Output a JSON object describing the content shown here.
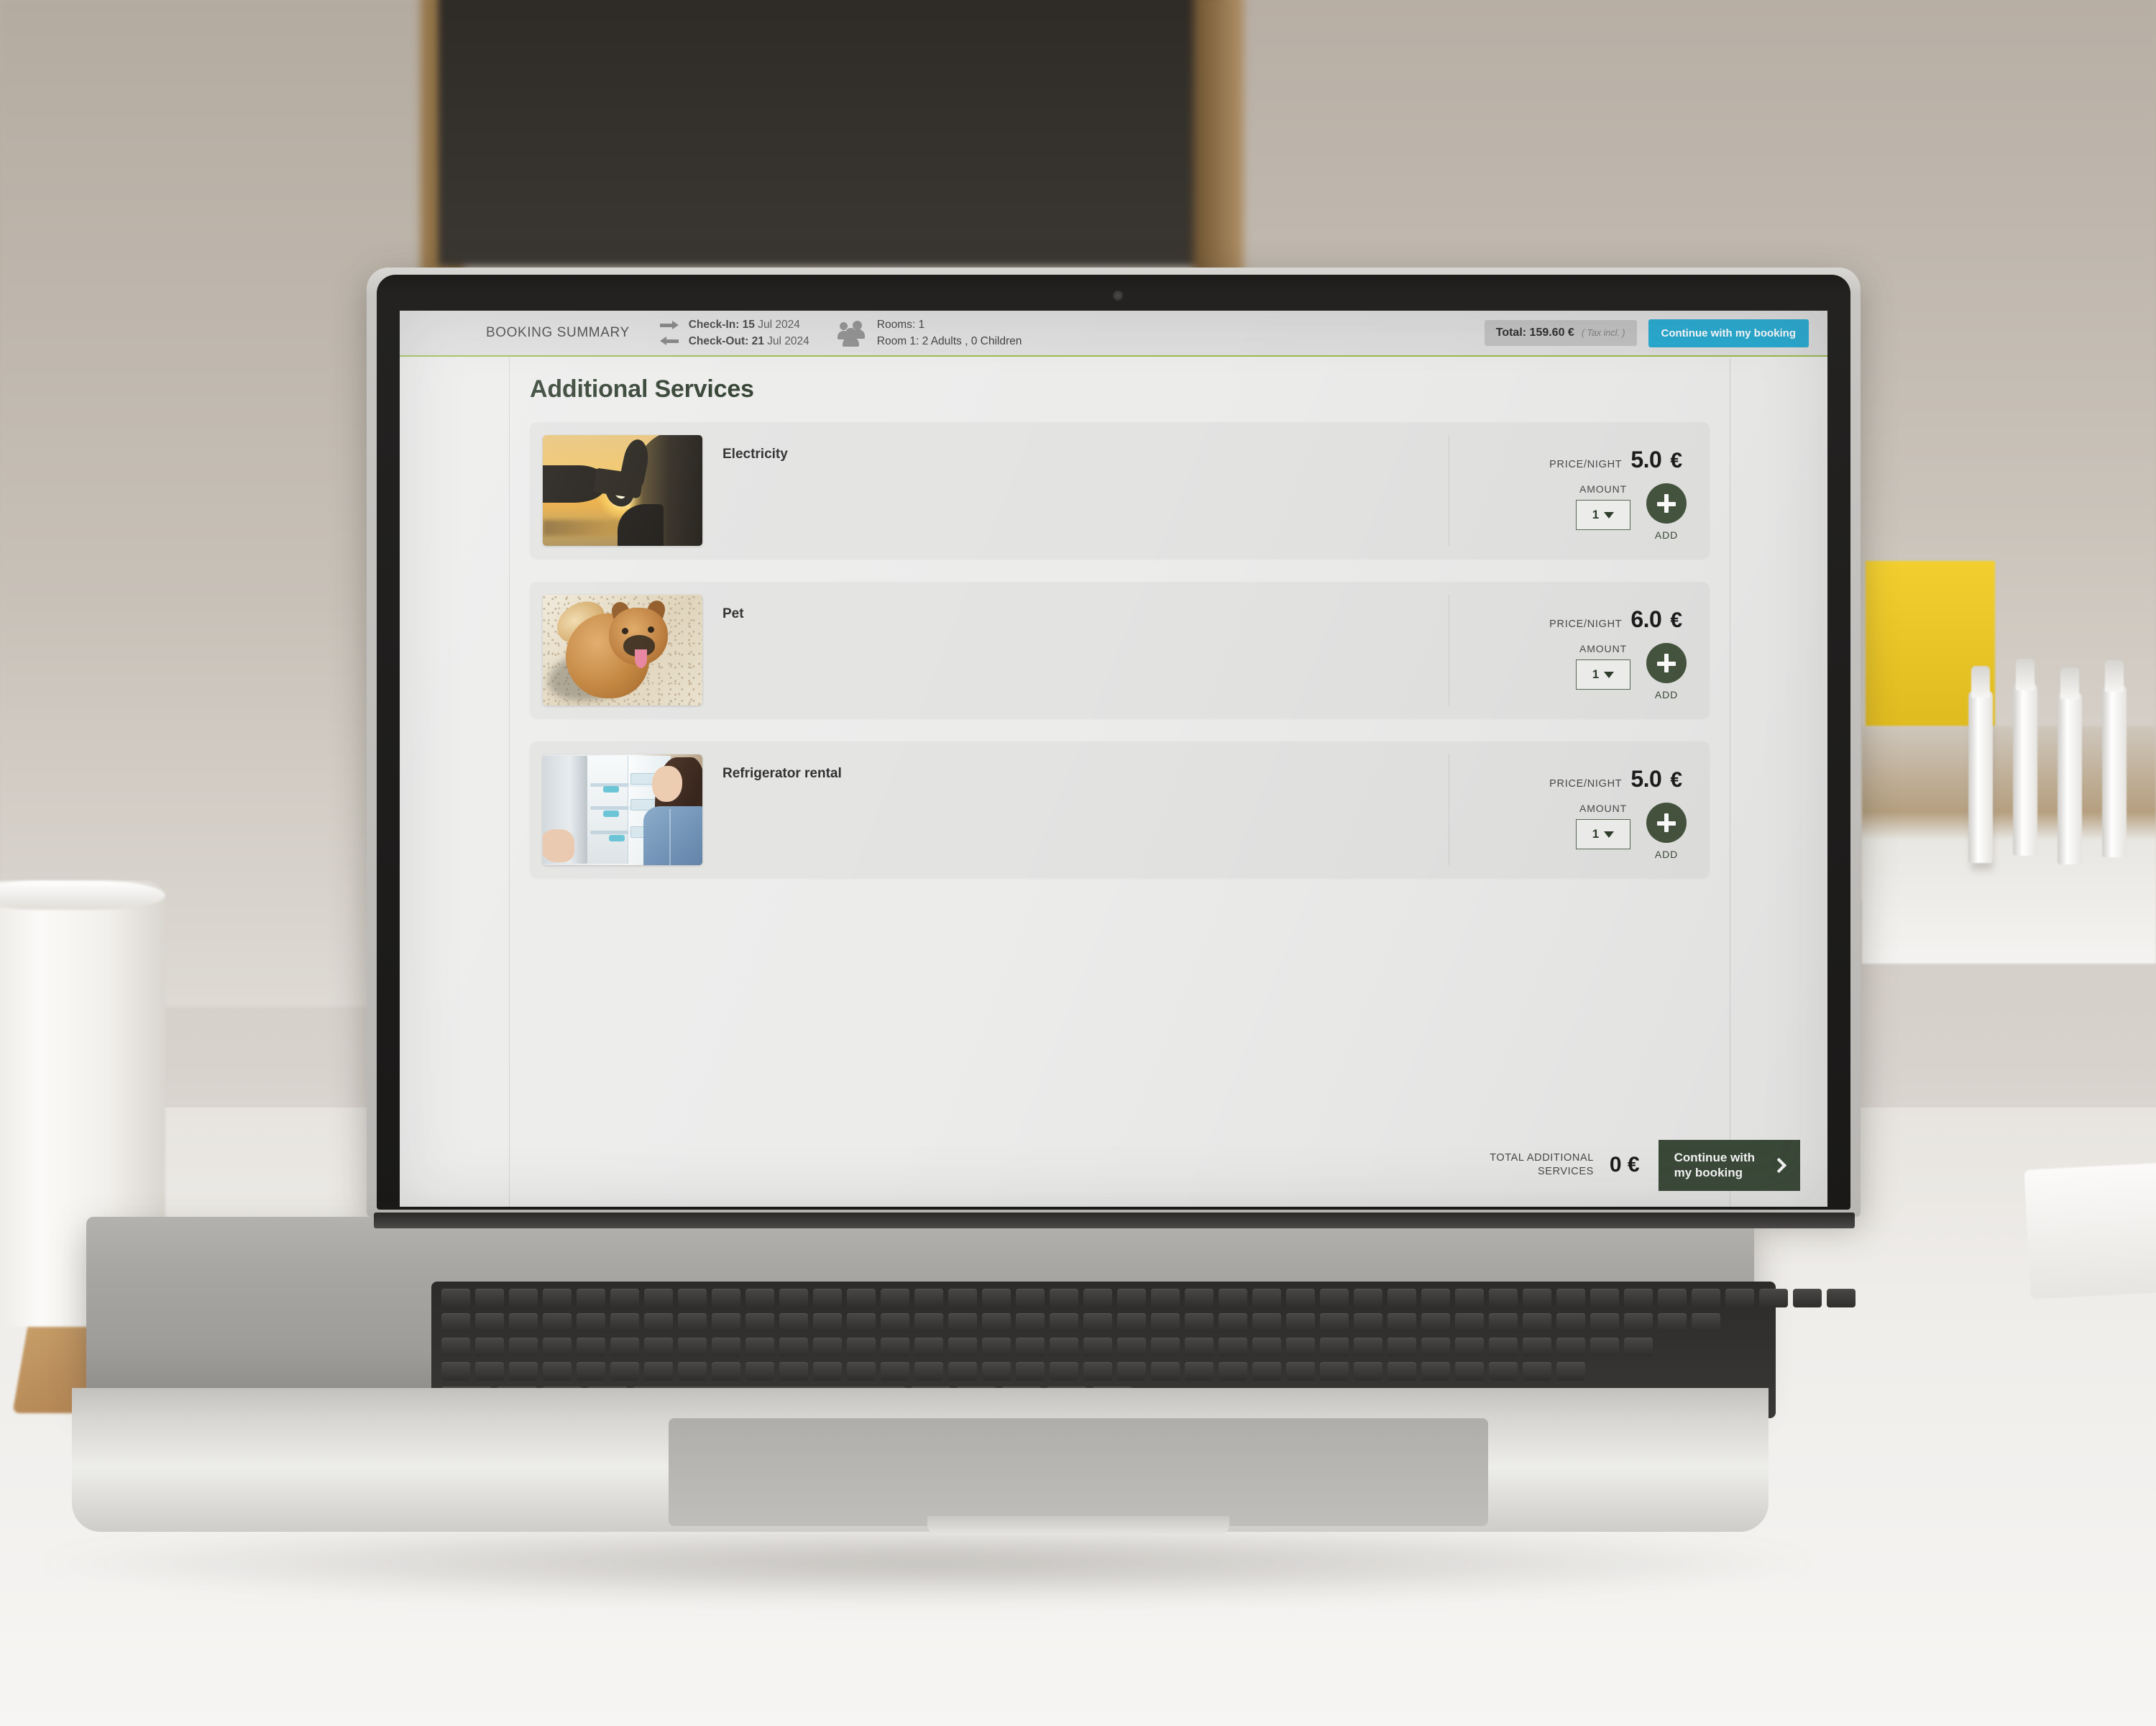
{
  "header": {
    "booking_summary_label": "BOOKING SUMMARY",
    "checkin_label": "Check-In:",
    "checkin_day": "15",
    "checkin_rest": "Jul 2024",
    "checkout_label": "Check-Out:",
    "checkout_day": "21",
    "checkout_rest": "Jul 2024",
    "rooms_line": "Rooms: 1",
    "occupancy_line": "Room 1: 2 Adults , 0 Children",
    "total_text": "Total: 159.60 €",
    "tax_note": "( Tax incl. )",
    "continue_button": "Continue with my booking",
    "accent_blue": "#29abd2",
    "accent_green_line": "#9cbb4e"
  },
  "page": {
    "title": "Additional Services"
  },
  "services": [
    {
      "name": "Electricity",
      "image_alt": "ev-charging-sunset-photo",
      "price_label": "PRICE/NIGHT",
      "price_value": "5.0",
      "currency": "€",
      "amount_label": "AMOUNT",
      "amount_value": "1",
      "add_label": "ADD"
    },
    {
      "name": "Pet",
      "image_alt": "pomeranian-dog-on-sand-photo",
      "price_label": "PRICE/NIGHT",
      "price_value": "6.0",
      "currency": "€",
      "amount_label": "AMOUNT",
      "amount_value": "1",
      "add_label": "ADD"
    },
    {
      "name": "Refrigerator rental",
      "image_alt": "woman-opening-refrigerator-photo",
      "price_label": "PRICE/NIGHT",
      "price_value": "5.0",
      "currency": "€",
      "amount_label": "AMOUNT",
      "amount_value": "1",
      "add_label": "ADD"
    }
  ],
  "footer": {
    "total_label_line1": "TOTAL ADDITIONAL",
    "total_label_line2": "SERVICES",
    "total_value": "0 €",
    "continue_line1": "Continue with",
    "continue_line2": "my booking",
    "accent_green": "#3c4b3a"
  }
}
